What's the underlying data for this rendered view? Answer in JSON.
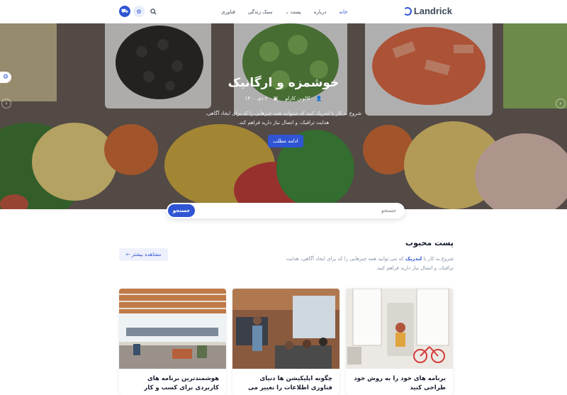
{
  "brand": {
    "name": "Landrick"
  },
  "nav": {
    "items": [
      {
        "label": "خانه",
        "active": true
      },
      {
        "label": "درباره"
      },
      {
        "label": "پست"
      },
      {
        "label": "سبک زندگی"
      },
      {
        "label": "فناوری"
      }
    ],
    "icons": [
      "search-icon",
      "gear-icon",
      "cart-icon"
    ]
  },
  "hero": {
    "title": "خوشمزه و ارگانیک",
    "author": "کالوین کارلو",
    "date": "۲ دی ۱۴۰۰",
    "description": "شروع به کار با لندریک کنید که میتوانید همه چیزهایی را که برای ایجاد آگاهی، هدایت ترافیک، و اتصال نیاز دارید فراهم کند.",
    "button_label": "ادامه مطلب"
  },
  "search": {
    "placeholder": "جستجو",
    "button_label": "جستجو"
  },
  "section": {
    "title": "پست محبوب",
    "desc_pre": "شروع به کار با",
    "desc_brand": "لندریک",
    "desc_post": "که می توانید همه چیزهایی را که برای ایجاد آگاهی، هدایت ترافیک، و اتصال نیاز دارید فراهم کنید.",
    "more_label": "مشاهده بیشتر ←"
  },
  "cards": [
    {
      "title": "برنامه های خود را به روش خود طراحی کنید"
    },
    {
      "title": "چگونه اپلیکیشن ها دنیای فناوری اطلاعات را تغییر می دهند"
    },
    {
      "title": "هوشمندترین برنامه های کاربردی برای کسب و کار"
    }
  ],
  "colors": {
    "accent": "#2f55d4",
    "text": "#161c2d",
    "muted": "#8492a6"
  }
}
